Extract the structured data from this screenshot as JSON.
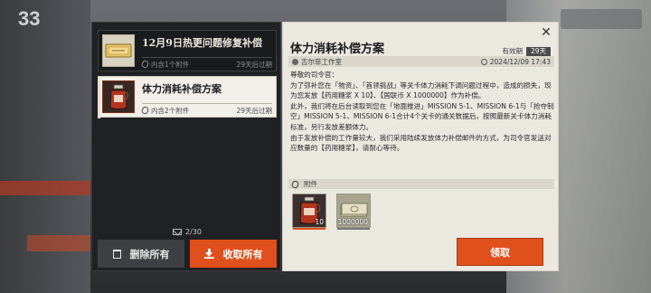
{
  "background": {
    "level": "33"
  },
  "mail_list": {
    "items": [
      {
        "title": "12月9日热更问题修复补偿",
        "attachments": "内含1个附件",
        "expires": "29天后过期",
        "icon": "ticket-icon",
        "selected": false
      },
      {
        "title": "体力消耗补偿方案",
        "attachments": "内含2个附件",
        "expires": "29天后过期",
        "icon": "drink-can-icon",
        "selected": true
      }
    ],
    "count": "2/30",
    "delete_all_label": "删除所有",
    "collect_all_label": "收取所有"
  },
  "detail": {
    "title": "体力消耗补偿方案",
    "validity_label": "有效期",
    "validity_days": "29天",
    "sender": "吉尔菲工作室",
    "date": "2024/12/09 17:43",
    "body": [
      "尊敬的司令官：",
      "为了弥补您在「物资」、「首领挑战」等关卡体力消耗下调问题过程中，造成的损失，现为您发放【药用糖浆 X 10】、【国联币 X 1000000】作为补偿。",
      "此外，我们将在后台读取到您在「地面推进」MISSION 5-1、MISSION 6-1与「抢夺制空」MISSION 5-1、MISSION 6-1合计4个关卡的通关数据后，按照最新关卡体力消耗标准，另行发放差额体力。",
      "由于发放补偿的工作量较大，我们采用陆续发放体力补偿邮件的方式，为司令官发送对应数量的【药用糖浆】，请耐心等待。"
    ],
    "attachments_label": "附件",
    "attachments": [
      {
        "name": "药用糖浆",
        "icon": "drink-can-icon",
        "qty": "10"
      },
      {
        "name": "国联币",
        "icon": "money-stack-icon",
        "qty": "1000000"
      }
    ],
    "claim_label": "领取"
  },
  "colors": {
    "accent": "#e0501c",
    "panel_dark": "#202124",
    "panel_light": "#ebe8e0"
  }
}
